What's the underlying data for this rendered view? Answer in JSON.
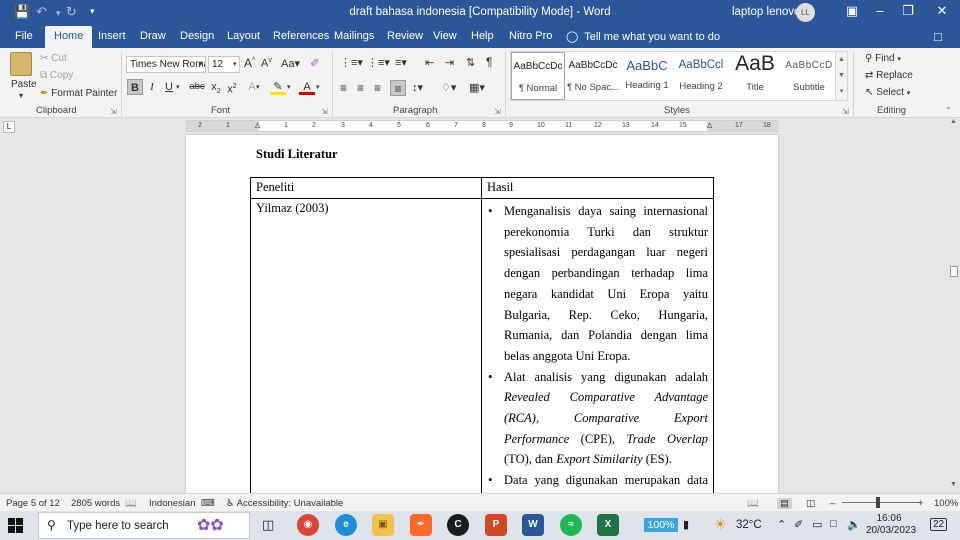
{
  "window": {
    "title": "draft bahasa indonesia [Compatibility Mode]  -  Word",
    "user_name": "laptop lenovo",
    "user_initials": "LL"
  },
  "ribbon_tabs": [
    "File",
    "Home",
    "Insert",
    "Draw",
    "Design",
    "Layout",
    "References",
    "Mailings",
    "Review",
    "View",
    "Help",
    "Nitro Pro"
  ],
  "tell_me": "Tell me what you want to do",
  "clipboard": {
    "paste": "Paste",
    "cut": "Cut",
    "copy": "Copy",
    "format_painter": "Format Painter",
    "group_label": "Clipboard"
  },
  "font": {
    "family": "Times New Roma",
    "size": "12",
    "group_label": "Font"
  },
  "paragraph": {
    "group_label": "Paragraph"
  },
  "styles": {
    "group_label": "Styles",
    "items": [
      {
        "sample": "AaBbCcDc",
        "name": "¶ Normal"
      },
      {
        "sample": "AaBbCcDc",
        "name": "¶ No Spac..."
      },
      {
        "sample": "AaBbC",
        "name": "Heading 1"
      },
      {
        "sample": "AaBbCcl",
        "name": "Heading 2"
      },
      {
        "sample": "AaB",
        "name": "Title"
      },
      {
        "sample": "AaBbCcD",
        "name": "Subtitle"
      }
    ]
  },
  "editing": {
    "find": "Find",
    "replace": "Replace",
    "select": "Select",
    "group_label": "Editing"
  },
  "ruler": {
    "numbers": [
      "2",
      "1",
      "1",
      "2",
      "3",
      "4",
      "5",
      "6",
      "7",
      "8",
      "9",
      "10",
      "11",
      "12",
      "13",
      "14",
      "15",
      "17",
      "18"
    ]
  },
  "document": {
    "heading": "Studi Literatur",
    "table": {
      "headers": [
        "Peneliti",
        "Hasil"
      ],
      "row": {
        "researcher": "Yilmaz (2003)",
        "b1": "Menganalisis daya saing internasional perekonomia Turki dan struktur spesialisasi perdagangan luar negeri dengan perbandingan terhadap lima negara kandidat Uni Eropa yaitu Bulgaria, Rep. Ceko, Hungaria, Rumania, dan Polandia dengan lima belas anggota Uni Eropa.",
        "b2_lead": "Alat analisis yang digunakan adalah ",
        "b2_rca": "Revealed Comparative Advantage (RCA)",
        "b2_sep1": ", ",
        "b2_cpe": "Comparative Export Performance",
        "b2_sep2": " (CPE), ",
        "b2_to": "Trade Overlap",
        "b2_sep3": " (TO), dan ",
        "b2_es": "Export Similarity",
        "b2_end": " (ES).",
        "b3": "Data yang digunakan merupakan data dari"
      }
    }
  },
  "status_bar": {
    "page": "Page 5 of 12",
    "words": "2805 words",
    "language": "Indonesian",
    "accessibility": "Accessibility: Unavailable",
    "zoom": "100%"
  },
  "taskbar": {
    "search_placeholder": "Type here to search",
    "battery": "100%",
    "temperature": "32°C",
    "time": "16:06",
    "date": "20/03/2023",
    "notifications": "22"
  }
}
